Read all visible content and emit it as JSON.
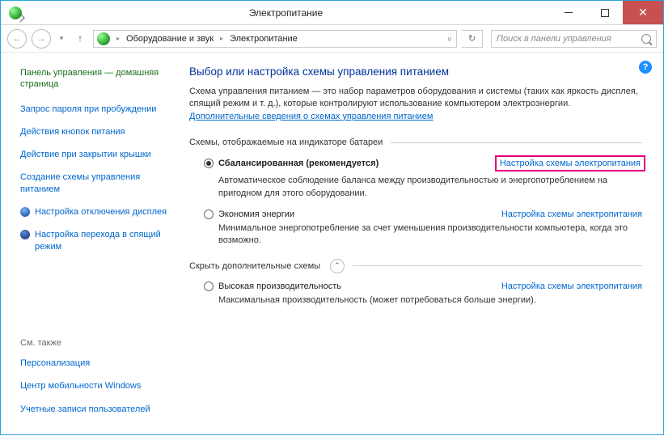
{
  "window": {
    "title": "Электропитание"
  },
  "toolbar": {
    "breadcrumb": [
      "Оборудование и звук",
      "Электропитание"
    ],
    "search_placeholder": "Поиск в панели управления"
  },
  "sidebar": {
    "home": "Панель управления — домашняя страница",
    "links": [
      "Запрос пароля при пробуждении",
      "Действия кнопок питания",
      "Действие при закрытии крышки",
      "Создание схемы управления питанием",
      "Настройка отключения дисплея",
      "Настройка перехода в спящий режим"
    ],
    "see_also_title": "См. также",
    "see_also": [
      "Персонализация",
      "Центр мобильности Windows",
      "Учетные записи пользователей"
    ]
  },
  "main": {
    "heading": "Выбор или настройка схемы управления питанием",
    "description_pre": "Схема управления питанием — это набор параметров оборудования и системы (таких как яркость дисплея, спящий режим и т. д.), которые контролируют использование компьютером электроэнергии. ",
    "description_link": "Дополнительные сведения о схемах управления питанием",
    "group1_title": "Схемы, отображаемые на индикаторе батареи",
    "group2_title": "Скрыть дополнительные схемы",
    "change_link": "Настройка схемы электропитания",
    "plans": {
      "balanced": {
        "name": "Сбалансированная (рекомендуется)",
        "desc": "Автоматическое соблюдение баланса между производительностью и энергопотреблением на пригодном для этого оборудовании."
      },
      "saver": {
        "name": "Экономия энергии",
        "desc": "Минимальное энергопотребление за счет уменьшения производительности компьютера, когда это возможно."
      },
      "high": {
        "name": "Высокая производительность",
        "desc": "Максимальная производительность (может потребоваться больше энергии)."
      }
    }
  }
}
